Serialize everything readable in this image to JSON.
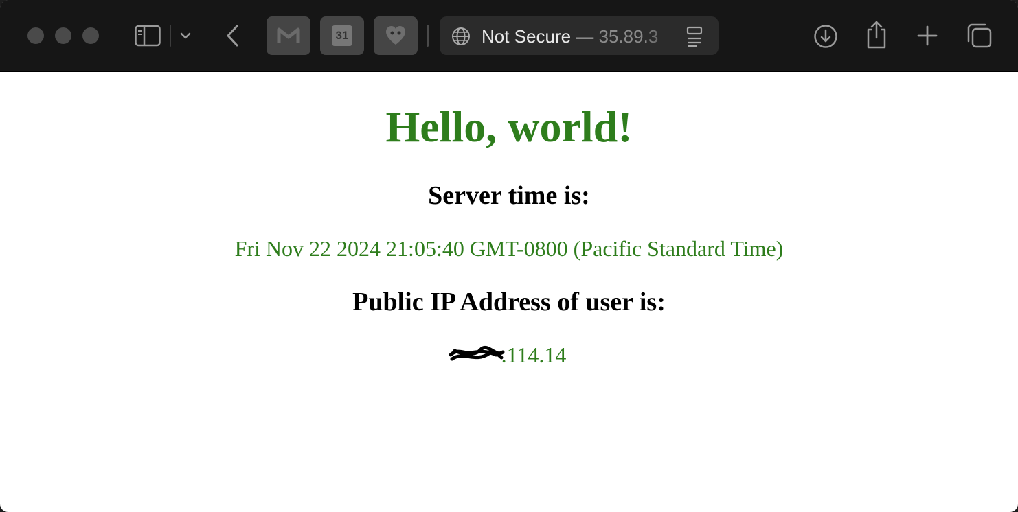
{
  "browser": {
    "address_bar": {
      "security_label": "Not Secure —",
      "host": "35.89.3"
    },
    "tabs": [
      {
        "icon": "gmail-icon"
      },
      {
        "icon": "calendar-icon",
        "label": "31"
      },
      {
        "icon": "heart-icon"
      }
    ]
  },
  "page": {
    "heading": "Hello, world!",
    "server_time_label": "Server time is:",
    "server_time_value": "Fri Nov 22 2024 21:05:40 GMT-0800 (Pacific Standard Time)",
    "ip_label": "Public IP Address of user is:",
    "ip_visible_part": ".114.14"
  },
  "colors": {
    "accent_green": "#2e7d1c",
    "toolbar_bg": "#161616"
  }
}
